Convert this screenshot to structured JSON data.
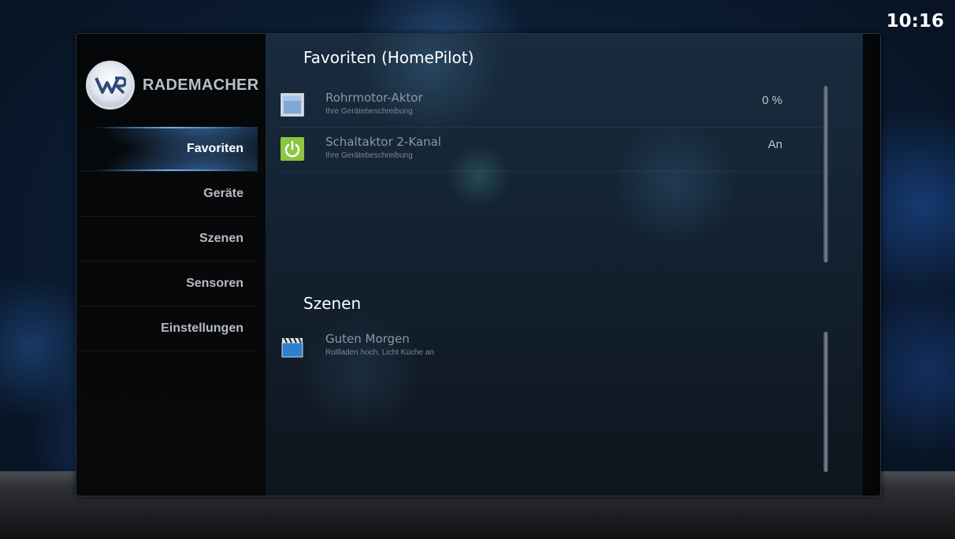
{
  "clock": "10:16",
  "brand": {
    "name": "RADEMACHER",
    "logo_letters": "WR",
    "logo_icon": "rademacher-logo-icon"
  },
  "close_button": {
    "label": "×",
    "icon": "close-icon"
  },
  "nav": {
    "items": [
      {
        "label": "Favoriten",
        "active": true
      },
      {
        "label": "Geräte",
        "active": false
      },
      {
        "label": "Szenen",
        "active": false
      },
      {
        "label": "Sensoren",
        "active": false
      },
      {
        "label": "Einstellungen",
        "active": false
      }
    ]
  },
  "favorites": {
    "title": "Favoriten (HomePilot)",
    "items": [
      {
        "title": "Rohrmotor-Aktor",
        "subtitle": "Ihre Gerätebeschreibung",
        "value": "0 %",
        "icon": "shutter-icon"
      },
      {
        "title": "Schaltaktor 2-Kanal",
        "subtitle": "Ihre Gerätebeschreibung",
        "value": "An",
        "icon": "power-icon"
      }
    ]
  },
  "scenes": {
    "title": "Szenen",
    "items": [
      {
        "title": "Guten Morgen",
        "subtitle": "Rollladen hoch, Licht Küche an",
        "icon": "clapperboard-icon"
      }
    ]
  },
  "colors": {
    "accent": "#5aa8ff",
    "power_icon": "#8cc63f",
    "text_muted": "#8c97a3"
  }
}
